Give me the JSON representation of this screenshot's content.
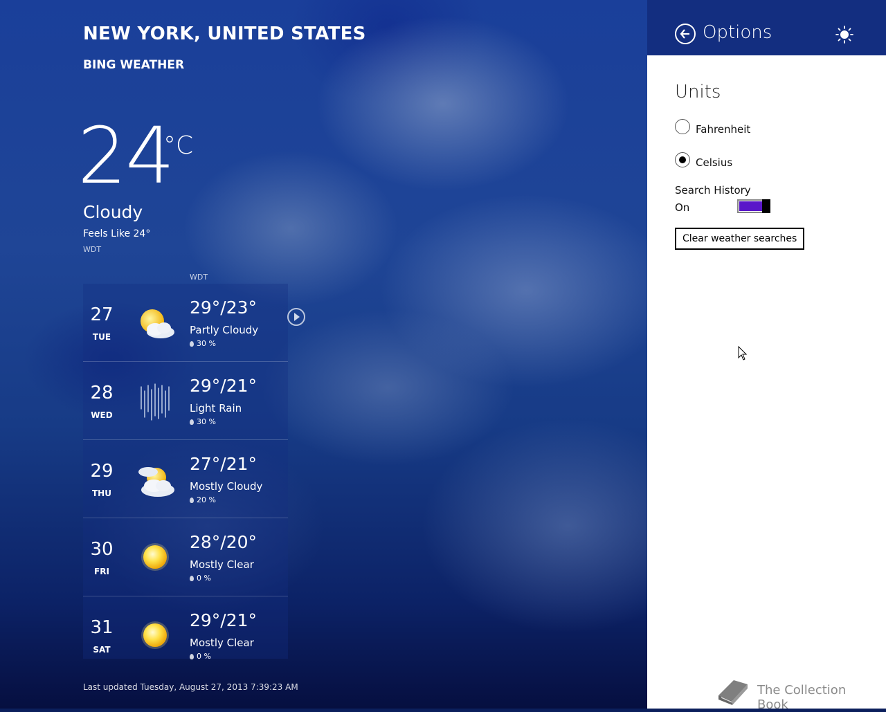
{
  "location": "NEW YORK, UNITED STATES",
  "app_name": "BING WEATHER",
  "current": {
    "temp": "24",
    "unit": "°C",
    "condition": "Cloudy",
    "feels_like": "Feels Like 24°",
    "timezone": "WDT"
  },
  "forecast_timezone": "WDT",
  "forecast": [
    {
      "day": "27",
      "weekday": "TUE",
      "hilo": "29°/23°",
      "condition": "Partly Cloudy",
      "precip": "30 %",
      "icon": "partly-cloudy-icon"
    },
    {
      "day": "28",
      "weekday": "WED",
      "hilo": "29°/21°",
      "condition": "Light Rain",
      "precip": "30 %",
      "icon": "light-rain-icon"
    },
    {
      "day": "29",
      "weekday": "THU",
      "hilo": "27°/21°",
      "condition": "Mostly Cloudy",
      "precip": "20 %",
      "icon": "mostly-cloudy-icon"
    },
    {
      "day": "30",
      "weekday": "FRI",
      "hilo": "28°/20°",
      "condition": "Mostly Clear",
      "precip": "0 %",
      "icon": "sun-icon"
    },
    {
      "day": "31",
      "weekday": "SAT",
      "hilo": "29°/21°",
      "condition": "Mostly Clear",
      "precip": "0 %",
      "icon": "sun-icon"
    }
  ],
  "last_updated": "Last updated Tuesday, August 27, 2013 7:39:23 AM",
  "options": {
    "title": "Options",
    "units_heading": "Units",
    "fahrenheit_label": "Fahrenheit",
    "celsius_label": "Celsius",
    "selected_unit": "Celsius",
    "search_history_label": "Search History",
    "search_history_state": "On",
    "clear_button": "Clear weather searches",
    "header_color": "#132e80",
    "toggle_color": "#5a17c9"
  },
  "watermark": "The Collection Book"
}
